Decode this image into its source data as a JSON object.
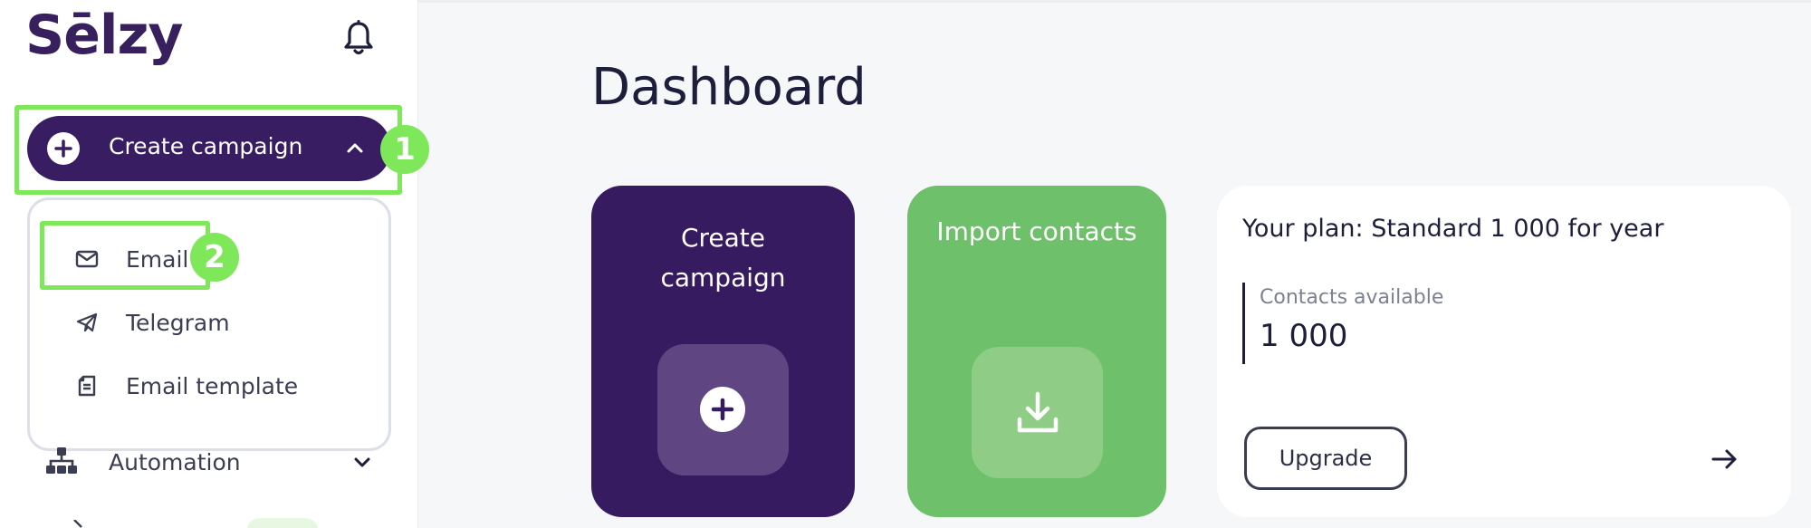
{
  "sidebar": {
    "logo": "Sēlzy",
    "create_campaign_label": "Create campaign",
    "dropdown_items": [
      {
        "label": "Email",
        "icon": "mail-icon"
      },
      {
        "label": "Telegram",
        "icon": "telegram-icon"
      },
      {
        "label": "Email template",
        "icon": "template-icon"
      }
    ],
    "automation_label": "Automation"
  },
  "annotations": {
    "step1": "1",
    "step2": "2",
    "highlight_color": "#7ee85a"
  },
  "main": {
    "title": "Dashboard",
    "cards": {
      "create_campaign": "Create campaign",
      "import_contacts": "Import contacts",
      "plan": {
        "title": "Your plan: Standard 1 000 for year",
        "contacts_label": "Contacts available",
        "contacts_value": "1 000",
        "upgrade_label": "Upgrade"
      }
    }
  },
  "colors": {
    "brand_purple": "#381d63",
    "brand_green": "#6fc06a"
  }
}
